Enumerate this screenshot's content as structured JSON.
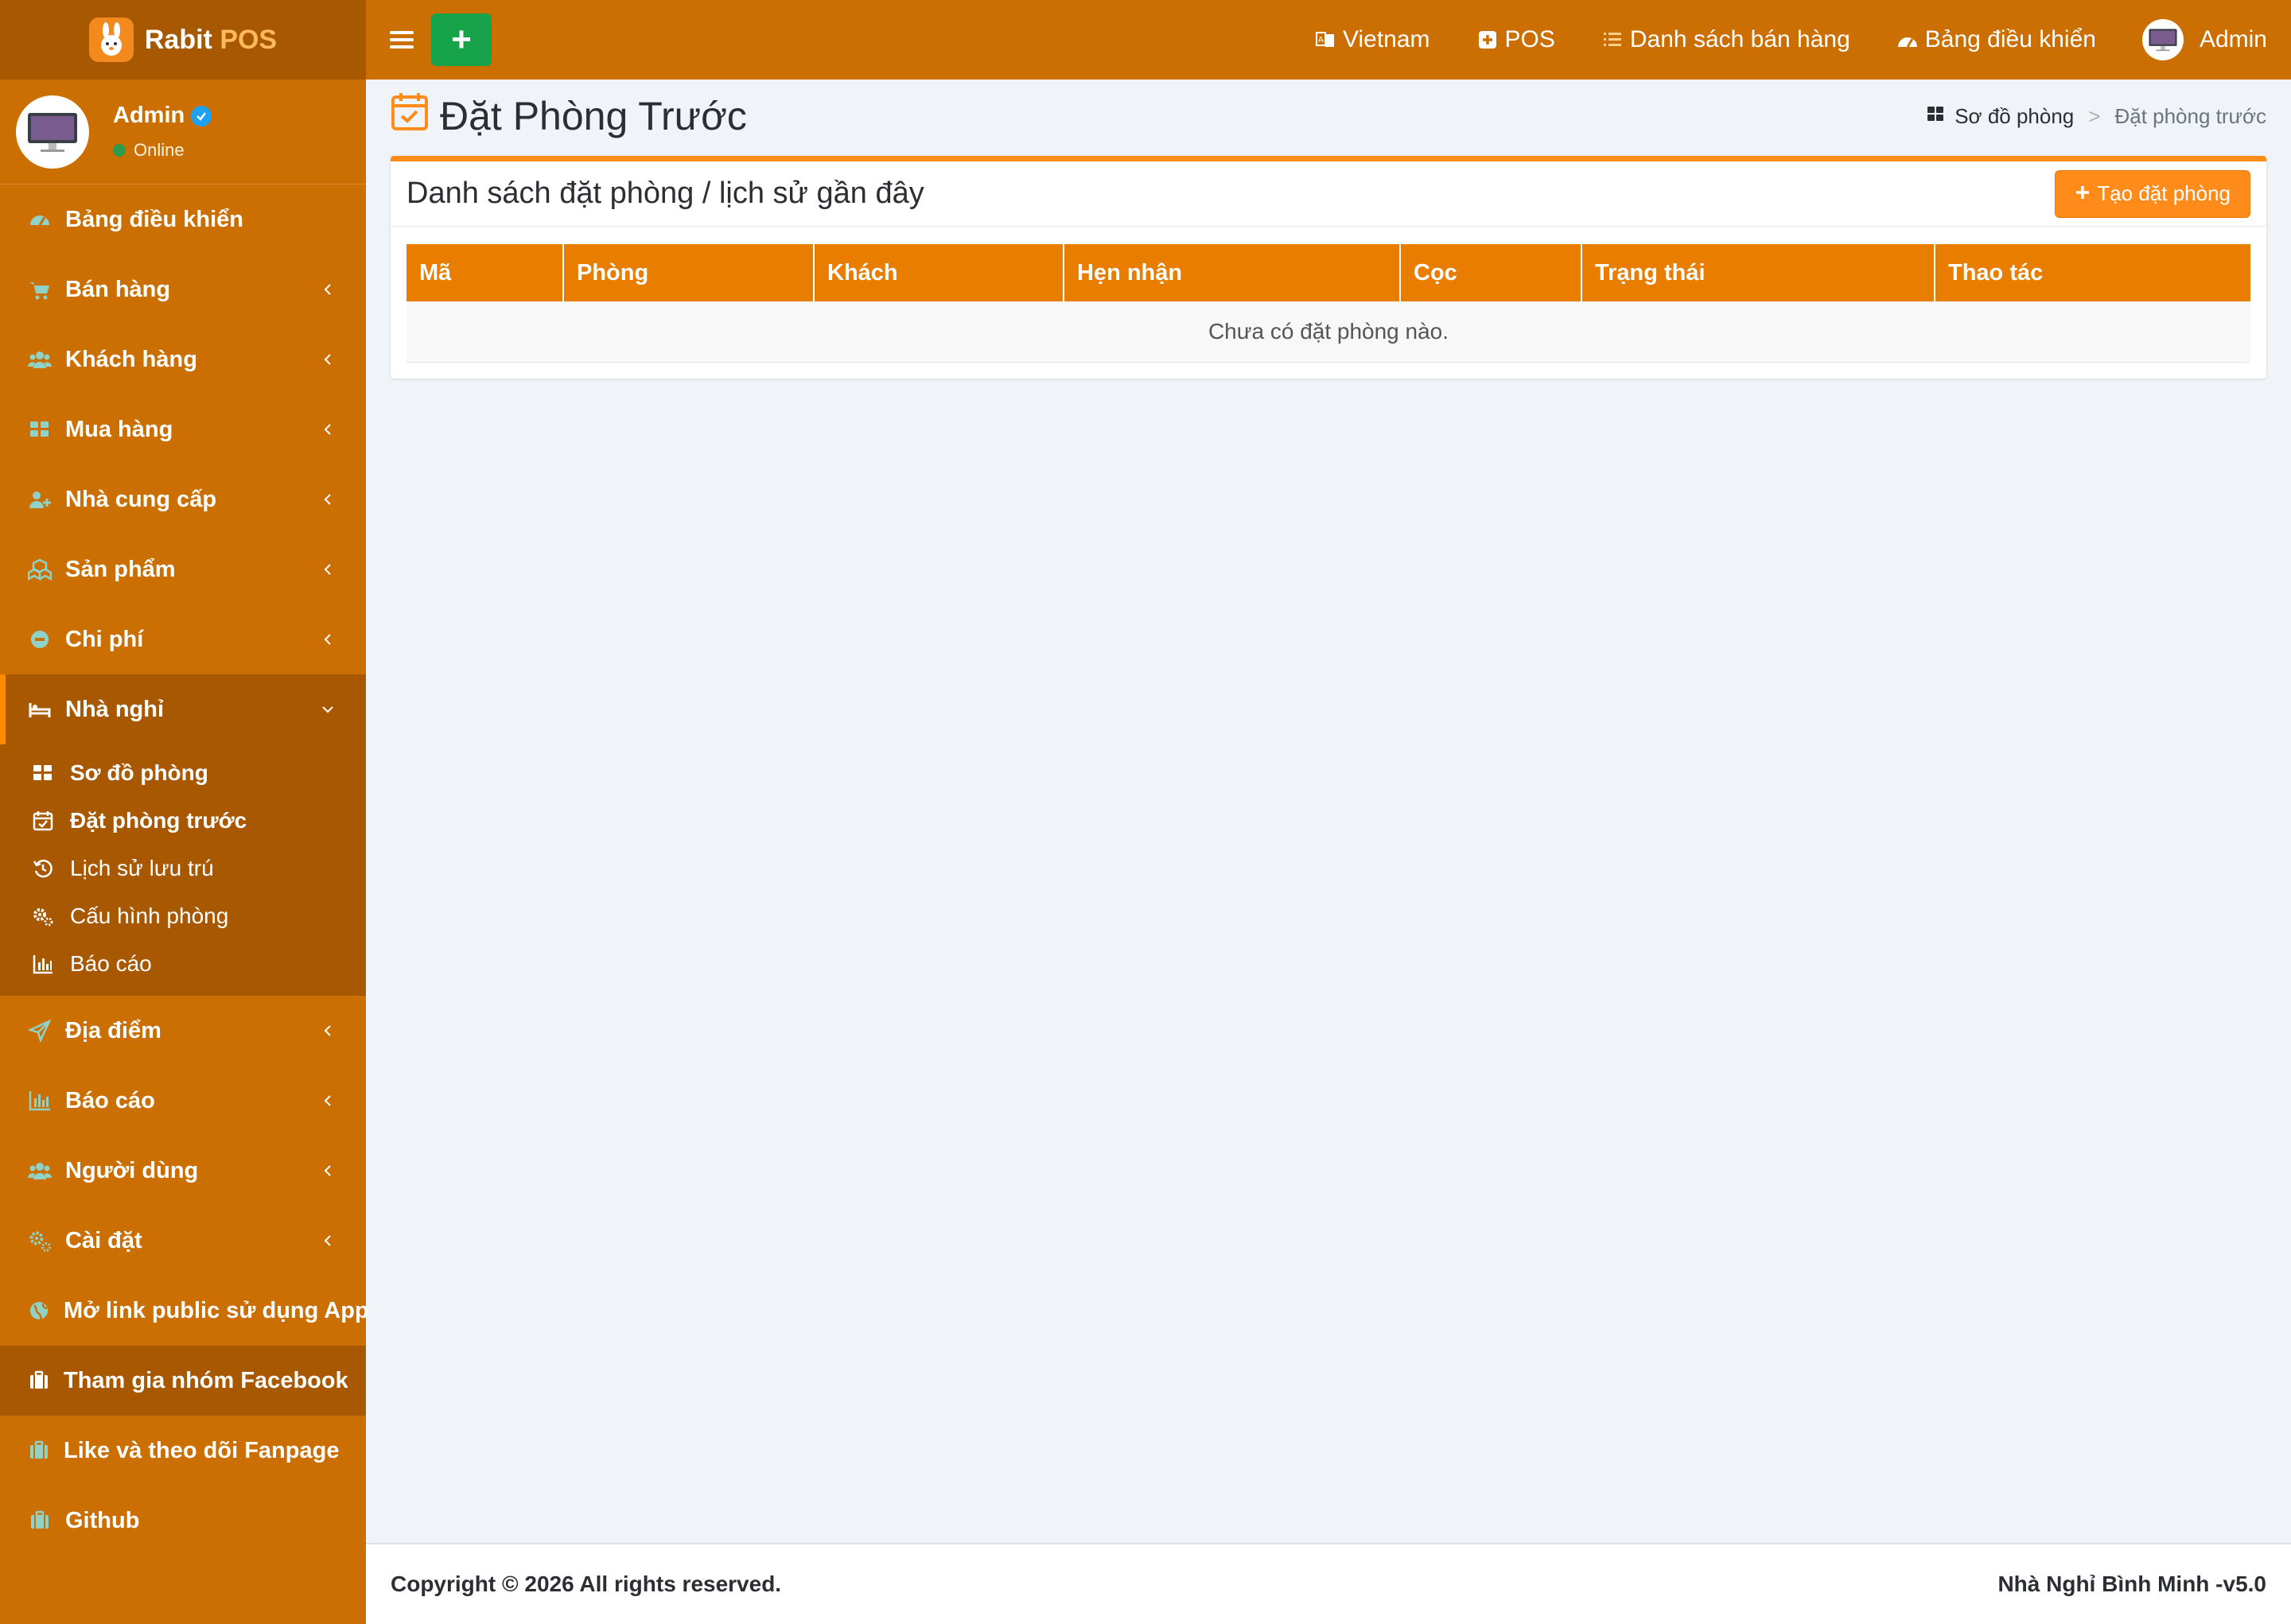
{
  "brand": {
    "name": "Rabit",
    "suffix": "POS"
  },
  "user": {
    "name": "Admin",
    "status": "Online"
  },
  "sidebar": {
    "items": [
      {
        "label": "Bảng điều khiển"
      },
      {
        "label": "Bán hàng"
      },
      {
        "label": "Khách hàng"
      },
      {
        "label": "Mua hàng"
      },
      {
        "label": "Nhà cung cấp"
      },
      {
        "label": "Sản phẩm"
      },
      {
        "label": "Chi phí"
      },
      {
        "label": "Nhà nghỉ"
      },
      {
        "label": "Địa điểm"
      },
      {
        "label": "Báo cáo"
      },
      {
        "label": "Người dùng"
      },
      {
        "label": "Cài đặt"
      },
      {
        "label": "Mở link public sử dụng App"
      },
      {
        "label": "Tham gia nhóm Facebook"
      },
      {
        "label": "Like và theo dõi Fanpage"
      },
      {
        "label": "Github"
      }
    ],
    "sub_items": [
      {
        "label": "Sơ đồ phòng"
      },
      {
        "label": "Đặt phòng trước"
      },
      {
        "label": "Lịch sử lưu trú"
      },
      {
        "label": "Cấu hình phòng"
      },
      {
        "label": "Báo cáo"
      }
    ]
  },
  "topbar": {
    "add_label": "+",
    "language": "Vietnam",
    "pos": "POS",
    "sales_list": "Danh sách bán hàng",
    "dashboard": "Bảng điều khiển",
    "user": "Admin"
  },
  "page": {
    "title": "Đặt Phòng Trước",
    "breadcrumb": [
      "Sơ đồ phòng",
      "Đặt phòng trước"
    ]
  },
  "card": {
    "title": "Danh sách đặt phòng / lịch sử gần đây",
    "create_button": "Tạo đặt phòng",
    "columns": [
      "Mã",
      "Phòng",
      "Khách",
      "Hẹn nhận",
      "Cọc",
      "Trạng thái",
      "Thao tác"
    ],
    "empty_message": "Chưa có đặt phòng nào."
  },
  "footer": {
    "copyright": "Copyright © 2026 All rights reserved.",
    "version": "Nhà Nghỉ Bình Minh -v5.0"
  },
  "colors": {
    "sidebar": "#cc6f02",
    "sidebar_dark": "#a85800",
    "accent": "#ff8c1a",
    "table_header": "#e87d00",
    "add_button": "#16a34a",
    "icon_teal": "#8fd3c8"
  }
}
